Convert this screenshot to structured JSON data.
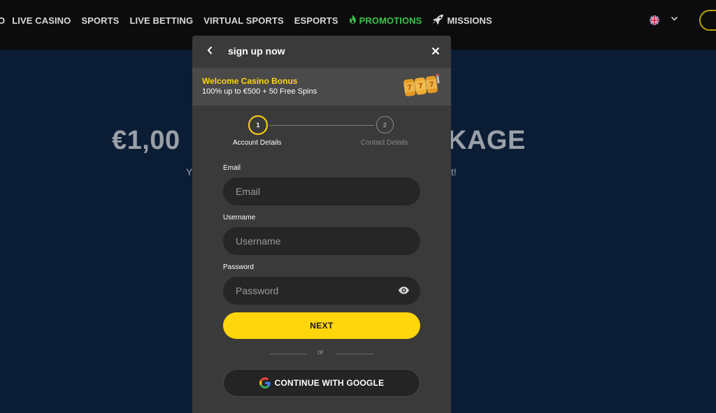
{
  "nav": {
    "items": [
      "O",
      "LIVE CASINO",
      "SPORTS",
      "LIVE BETTING",
      "VIRTUAL SPORTS",
      "ESPORTS",
      "PROMOTIONS",
      "MISSIONS"
    ],
    "promotions_icon": "flame-icon",
    "missions_icon": "rocket-icon",
    "accent_color": "#39c449"
  },
  "header": {
    "language_icon": "uk-flag-icon",
    "chevron_icon": "chevron-down-icon"
  },
  "hero": {
    "title_left": "€1,00",
    "title_right": "KAGE",
    "subtitle_left": "Y",
    "subtitle_right": "t!"
  },
  "modal": {
    "back_icon": "chevron-left-icon",
    "title": "sign up now",
    "close_icon": "close-icon",
    "bonus": {
      "title": "Welcome Casino Bonus",
      "description": "100% up to €500 + 50 Free Spins",
      "art_icon": "slot-reels-icon",
      "title_color": "#ffd50c"
    },
    "steps": [
      {
        "number": "1",
        "label": "Account Details",
        "active": true
      },
      {
        "number": "2",
        "label": "Contact Details",
        "active": false
      }
    ],
    "fields": {
      "email": {
        "label": "Email",
        "placeholder": "Email",
        "value": ""
      },
      "username": {
        "label": "Username",
        "placeholder": "Username",
        "value": ""
      },
      "password": {
        "label": "Password",
        "placeholder": "Password",
        "value": "",
        "toggle_icon": "eye-icon"
      }
    },
    "next_label": "NEXT",
    "or_label": "or",
    "google_label": "CONTINUE WITH GOOGLE",
    "google_icon": "google-icon",
    "primary_color": "#ffd50c"
  }
}
